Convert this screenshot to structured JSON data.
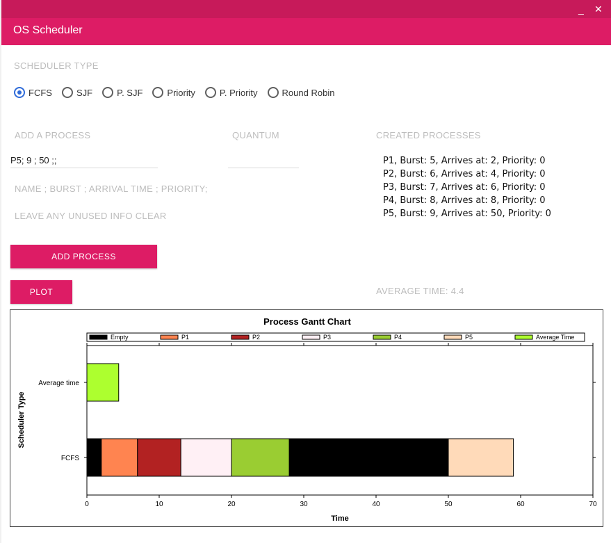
{
  "app": {
    "title": "OS Scheduler",
    "minimize": "_",
    "close": "✕"
  },
  "scheduler": {
    "label": "SCHEDULER TYPE",
    "options": [
      "FCFS",
      "SJF",
      "P. SJF",
      "Priority",
      "P. Priority",
      "Round Robin"
    ],
    "selected": "FCFS"
  },
  "add_process": {
    "label": "ADD A PROCESS",
    "value": "P5; 9 ; 50 ;;",
    "hint1": "NAME ; BURST ; ARRIVAL TIME ; PRIORITY;",
    "hint2": "LEAVE ANY UNUSED INFO CLEAR",
    "button": "ADD PROCESS"
  },
  "quantum": {
    "label": "QUANTUM",
    "value": ""
  },
  "created": {
    "label": "CREATED PROCESSES",
    "items": [
      "P1, Burst: 5, Arrives at: 2, Priority: 0",
      "P2, Burst: 6, Arrives at: 4, Priority: 0",
      "P3, Burst: 7, Arrives at: 6, Priority: 0",
      "P4, Burst: 8, Arrives at: 8, Priority: 0",
      "P5, Burst: 9, Arrives at: 50, Priority: 0"
    ]
  },
  "plot_button": "PLOT",
  "average_label": "AVERAGE TIME: 4.4",
  "colors": {
    "accent": "#dd1c65",
    "Empty": "#000000",
    "P1": "#ff8450",
    "P2": "#b22222",
    "P3": "#fff0f5",
    "P4": "#9acd32",
    "P5": "#ffdab9",
    "Average Time": "#adff2f"
  },
  "chart_data": {
    "type": "bar",
    "orientation": "horizontal-stacked-gantt",
    "title": "Process Gantt Chart",
    "xlabel": "Time",
    "ylabel": "Scheduler Type",
    "xlim": [
      0,
      70
    ],
    "xticks": [
      0,
      10,
      20,
      30,
      40,
      50,
      60,
      70
    ],
    "categories": [
      "FCFS",
      "Average time"
    ],
    "legend": [
      "Empty",
      "P1",
      "P2",
      "P3",
      "P4",
      "P5",
      "Average Time"
    ],
    "legend_position": "top",
    "series": [
      {
        "category": "FCFS",
        "name": "Empty",
        "start": 0,
        "end": 2
      },
      {
        "category": "FCFS",
        "name": "P1",
        "start": 2,
        "end": 7
      },
      {
        "category": "FCFS",
        "name": "P2",
        "start": 7,
        "end": 13
      },
      {
        "category": "FCFS",
        "name": "P3",
        "start": 13,
        "end": 20
      },
      {
        "category": "FCFS",
        "name": "P4",
        "start": 20,
        "end": 28
      },
      {
        "category": "FCFS",
        "name": "Empty",
        "start": 28,
        "end": 50
      },
      {
        "category": "FCFS",
        "name": "P5",
        "start": 50,
        "end": 59
      },
      {
        "category": "Average time",
        "name": "Average Time",
        "start": 0,
        "end": 4.4
      }
    ]
  }
}
